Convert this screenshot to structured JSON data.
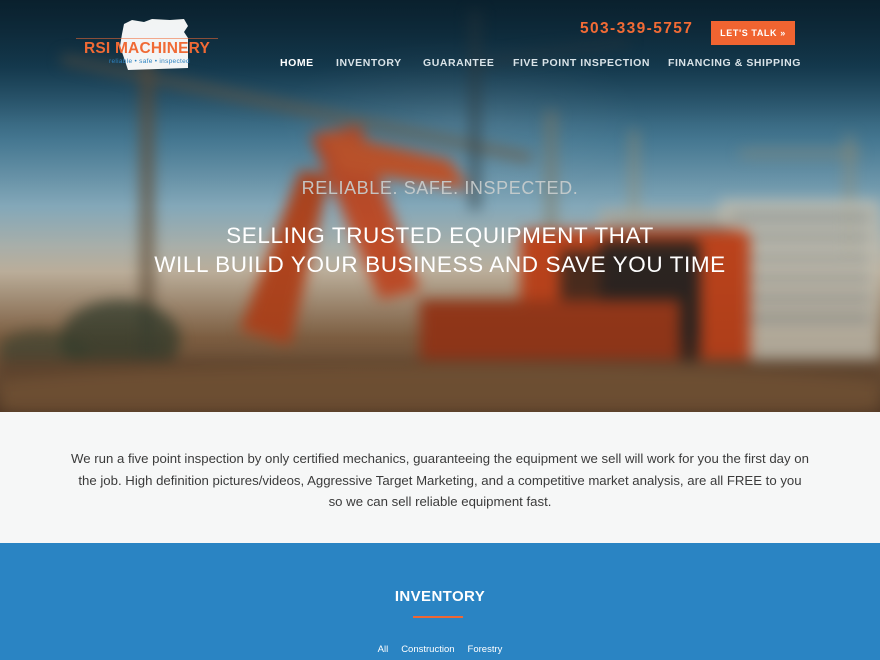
{
  "brand": {
    "name": "RSI MACHINERY",
    "tagline": "reliable • safe • inspected",
    "accent_color": "#f06431",
    "blue_color": "#2a84c3"
  },
  "header": {
    "phone": "503-339-5757",
    "cta_label": "LET'S TALK »"
  },
  "nav": {
    "items": [
      {
        "label": "HOME",
        "active": true
      },
      {
        "label": "INVENTORY",
        "active": false
      },
      {
        "label": "GUARANTEE",
        "active": false
      },
      {
        "label": "FIVE POINT INSPECTION",
        "active": false
      },
      {
        "label": "FINANCING & SHIPPING",
        "active": false
      }
    ]
  },
  "hero": {
    "subtitle": "RELIABLE. SAFE. INSPECTED.",
    "title_line1": "SELLING TRUSTED EQUIPMENT THAT",
    "title_line2": "WILL BUILD YOUR BUSINESS AND SAVE YOU TIME",
    "background": "blurred-construction-excavator-photo"
  },
  "intro": {
    "text": "We run a five point inspection by only certified mechanics, guaranteeing the equipment we sell will work for you the first day on the job. High definition pictures/videos, Aggressive Target Marketing, and a competitive market analysis, are all FREE to you so we can sell reliable equipment fast."
  },
  "inventory": {
    "title": "INVENTORY",
    "filters": [
      "All",
      "Construction",
      "Forestry"
    ]
  }
}
